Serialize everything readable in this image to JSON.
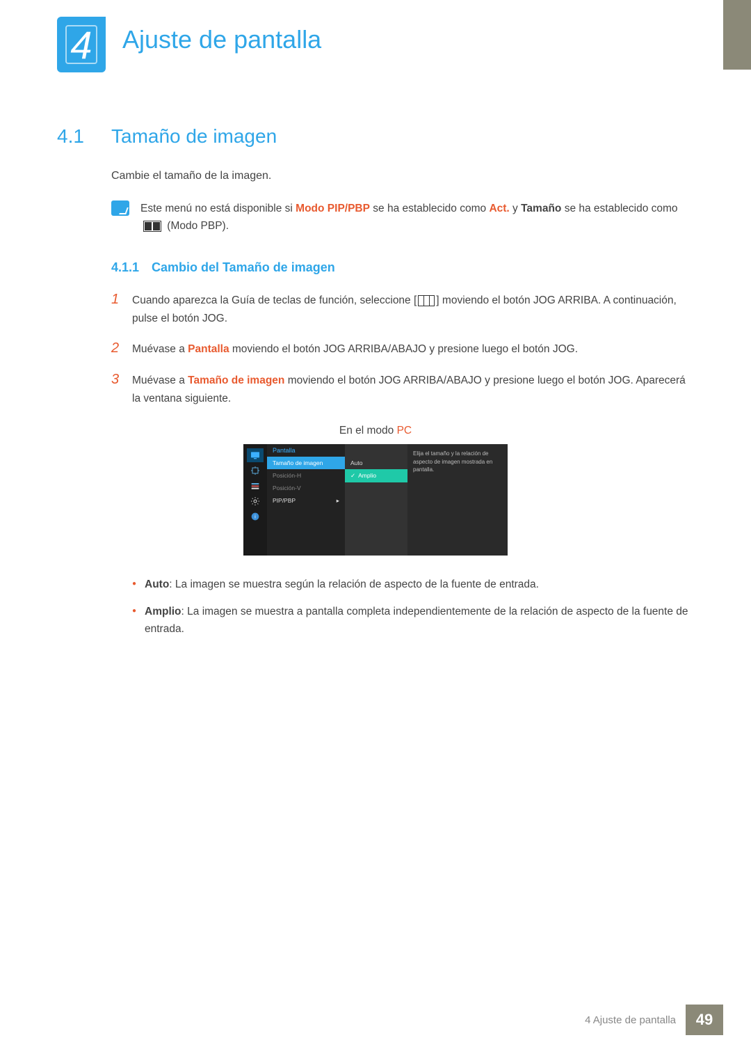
{
  "chapter": {
    "number": "4",
    "title": "Ajuste de pantalla"
  },
  "section": {
    "number": "4.1",
    "title": "Tamaño de imagen",
    "intro": "Cambie el tamaño de la imagen."
  },
  "note": {
    "pre": "Este menú no está disponible si ",
    "em1": "Modo PIP/PBP",
    "mid1": " se ha establecido como ",
    "em2": "Act.",
    "mid2": " y ",
    "em3": "Tamaño",
    "post1": " se ha establecido como ",
    "post2": " (Modo PBP)."
  },
  "subsection": {
    "number": "4.1.1",
    "title": "Cambio del Tamaño de imagen"
  },
  "steps": [
    {
      "n": "1",
      "pre": "Cuando aparezca la Guía de teclas de función, seleccione [",
      "post": "] moviendo el botón JOG ARRIBA. A continuación, pulse el botón JOG."
    },
    {
      "n": "2",
      "pre": "Muévase a ",
      "em": "Pantalla",
      "post": " moviendo el botón JOG ARRIBA/ABAJO y presione luego el botón JOG."
    },
    {
      "n": "3",
      "pre": "Muévase a ",
      "em": "Tamaño de imagen",
      "post": " moviendo el botón JOG ARRIBA/ABAJO y presione luego el botón JOG. Aparecerá la ventana siguiente."
    }
  ],
  "mode": {
    "pre": "En el modo ",
    "em": "PC"
  },
  "osd": {
    "header": "Pantalla",
    "items": [
      "Tamaño de imagen",
      "Posición-H",
      "Posición-V",
      "PIP/PBP"
    ],
    "options": [
      "Auto",
      "Amplio"
    ],
    "desc": "Elija el tamaño y la relación de aspecto de imagen mostrada en pantalla."
  },
  "bullets": [
    {
      "em": "Auto",
      "text": ": La imagen se muestra según la relación de aspecto de la fuente de entrada."
    },
    {
      "em": "Amplio",
      "text": ": La imagen se muestra a pantalla completa independientemente de la relación de aspecto de la fuente de entrada."
    }
  ],
  "footer": {
    "text": "4 Ajuste de pantalla",
    "page": "49"
  }
}
